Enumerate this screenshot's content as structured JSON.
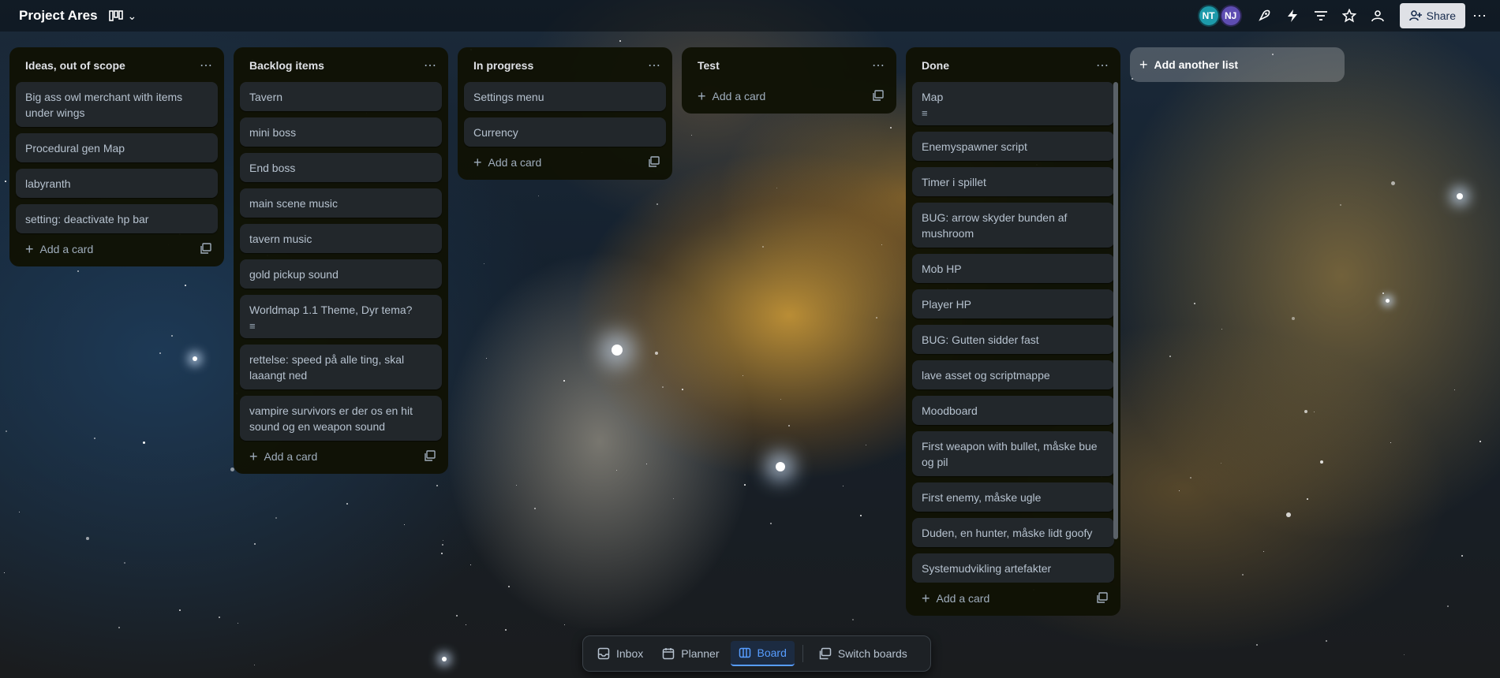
{
  "header": {
    "board_title": "Project Ares",
    "view_icon": "board-view-icon",
    "avatars": [
      {
        "initials": "NT",
        "color": "#1d9aaa"
      },
      {
        "initials": "NJ",
        "color": "#5e4db2"
      }
    ],
    "share_label": "Share"
  },
  "lists": [
    {
      "title": "Ideas, out of scope",
      "cards": [
        {
          "text": "Big ass owl merchant with items under wings"
        },
        {
          "text": "Procedural gen Map"
        },
        {
          "text": "labyranth"
        },
        {
          "text": "setting: deactivate hp bar"
        }
      ],
      "add_label": "Add a card"
    },
    {
      "title": "Backlog items",
      "cards": [
        {
          "text": "Tavern"
        },
        {
          "text": "mini boss"
        },
        {
          "text": "End boss"
        },
        {
          "text": "main scene music"
        },
        {
          "text": "tavern music"
        },
        {
          "text": "gold pickup sound"
        },
        {
          "text": "Worldmap 1.1 Theme, Dyr tema?",
          "has_description": true
        },
        {
          "text": "rettelse: speed på alle ting, skal laaangt ned"
        },
        {
          "text": "vampire survivors er der os en hit sound og en weapon sound"
        }
      ],
      "add_label": "Add a card"
    },
    {
      "title": "In progress",
      "cards": [
        {
          "text": "Settings menu"
        },
        {
          "text": "Currency"
        }
      ],
      "add_label": "Add a card"
    },
    {
      "title": "Test",
      "cards": [],
      "add_label": "Add a card"
    },
    {
      "title": "Done",
      "cards": [
        {
          "text": "Map",
          "has_description": true
        },
        {
          "text": "Enemyspawner script"
        },
        {
          "text": "Timer i spillet"
        },
        {
          "text": "BUG: arrow skyder bunden af mushroom"
        },
        {
          "text": "Mob HP"
        },
        {
          "text": "Player HP"
        },
        {
          "text": "BUG: Gutten sidder fast"
        },
        {
          "text": "lave asset og scriptmappe"
        },
        {
          "text": "Moodboard"
        },
        {
          "text": "First weapon with bullet, måske bue og pil"
        },
        {
          "text": "First enemy, måske ugle"
        },
        {
          "text": "Duden, en hunter, måske lidt goofy"
        },
        {
          "text": "Systemudvikling artefakter"
        }
      ],
      "add_label": "Add a card"
    }
  ],
  "add_list_label": "Add another list",
  "bottom_nav": {
    "inbox": "Inbox",
    "planner": "Planner",
    "board": "Board",
    "switch": "Switch boards"
  }
}
